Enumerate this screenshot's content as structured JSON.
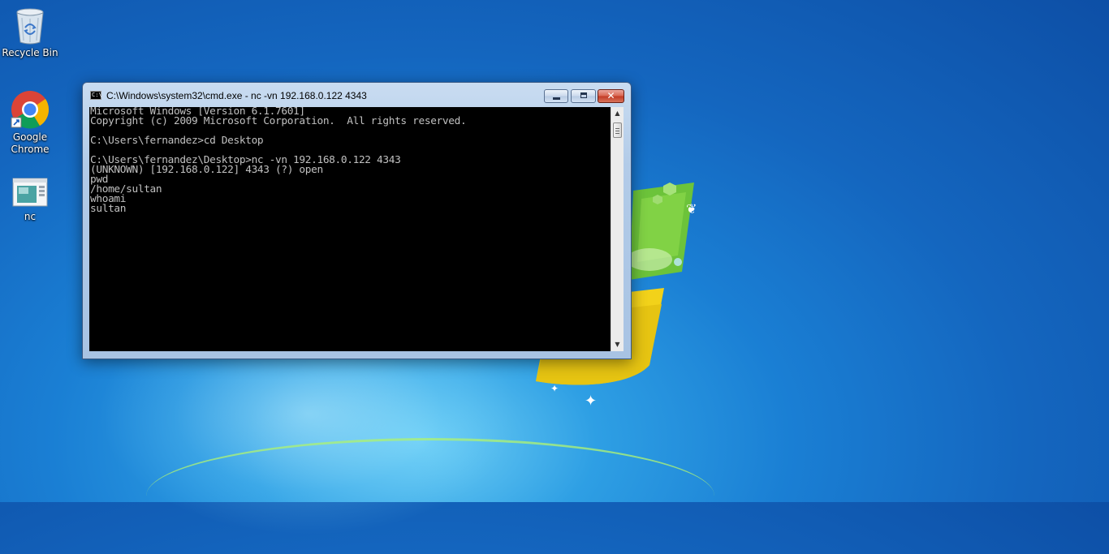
{
  "desktop": {
    "icons": [
      {
        "label": "Recycle Bin",
        "icon": "recycle-bin-icon"
      },
      {
        "label": "Google\nChrome",
        "icon": "chrome-icon"
      },
      {
        "label": "nc",
        "icon": "executable-icon"
      }
    ]
  },
  "window": {
    "title": "C:\\Windows\\system32\\cmd.exe - nc  -vn 192.168.0.122 4343",
    "icon": "cmd-icon",
    "controls": {
      "minimize": "minimize-icon",
      "maximize": "maximize-icon",
      "close": "✕"
    },
    "console_text": "Microsoft Windows [Version 6.1.7601]\nCopyright (c) 2009 Microsoft Corporation.  All rights reserved.\n\nC:\\Users\\fernandez>cd Desktop\n\nC:\\Users\\fernandez\\Desktop>nc -vn 192.168.0.122 4343\n(UNKNOWN) [192.168.0.122] 4343 (?) open\npwd\n/home/sultan\nwhoami\nsultan",
    "scrollbar": {
      "up": "▲",
      "down": "▼"
    }
  },
  "colors": {
    "console_bg": "#000000",
    "console_fg": "#c0c0c0",
    "desktop_blue": "#1a7fd4"
  }
}
